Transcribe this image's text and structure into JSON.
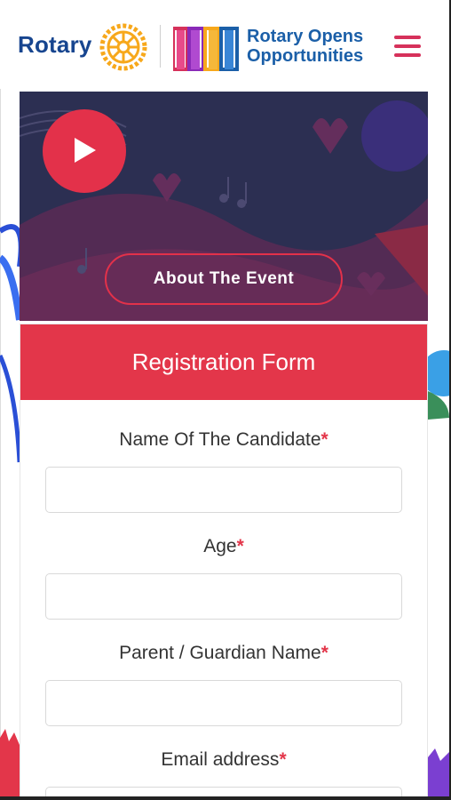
{
  "header": {
    "brand": "Rotary",
    "tagline_line1": "Rotary Opens",
    "tagline_line2": "Opportunities",
    "menu_icon": "hamburger-icon"
  },
  "video": {
    "play_icon": "play-icon",
    "about_label": "About The Event"
  },
  "form": {
    "title": "Registration Form",
    "fields": [
      {
        "label": "Name Of The Candidate",
        "required_mark": "*"
      },
      {
        "label": "Age",
        "required_mark": "*"
      },
      {
        "label": "Parent / Guardian Name",
        "required_mark": "*"
      },
      {
        "label": "Email address",
        "required_mark": "*"
      }
    ]
  },
  "colors": {
    "accent_red": "#e3364a",
    "rotary_blue": "#17458f",
    "rotary_gold": "#f7a81b",
    "menu_pink": "#d6315b"
  }
}
